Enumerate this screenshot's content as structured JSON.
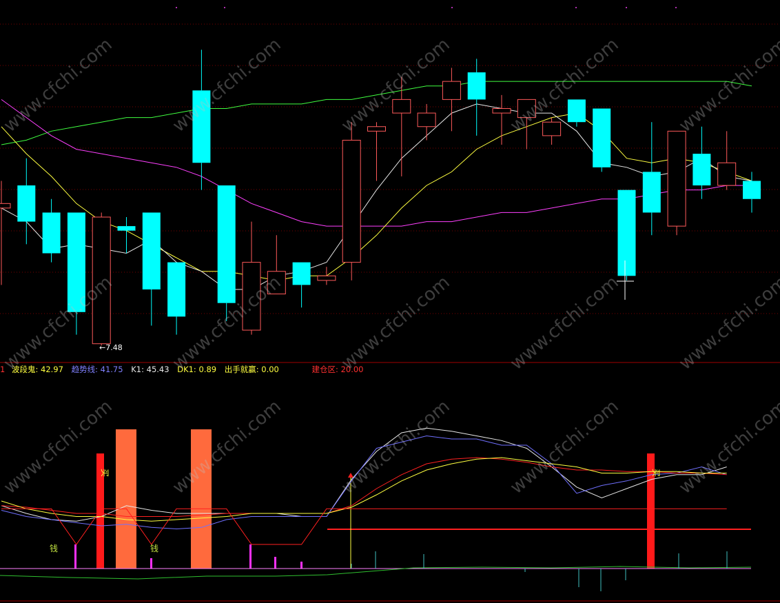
{
  "colors": {
    "background": "#000000",
    "up_candle": "#ff5a5a",
    "down_candle": "#00ffff",
    "grid": "#7a0000",
    "separator": "#a00000",
    "ma_white": "#e8e8e8",
    "ma_yellow": "#ffff40",
    "ma_magenta": "#ff40ff",
    "ma_green": "#40ff40"
  },
  "price_panel": {
    "low_marker": "←7.48"
  },
  "indicator_panel": {
    "prefix": "1",
    "legend": [
      {
        "label": "波段鬼: ",
        "value": "42.97",
        "color": "#ffff40",
        "label_color": "#ffff40"
      },
      {
        "label": "趋势线: ",
        "value": "41.75",
        "color": "#8080ff",
        "label_color": "#8080ff"
      },
      {
        "label": "K1: ",
        "value": "45.43",
        "color": "#e8e8e8",
        "label_color": "#e8e8e8"
      },
      {
        "label": "DK1: ",
        "value": "0.89",
        "color": "#ffff40",
        "label_color": "#ffff40"
      },
      {
        "label": "出手就赢: ",
        "value": "0.00",
        "color": "#ffff40",
        "label_color": "#ffff40"
      },
      {
        "label": "建仓区: ",
        "value": "20.00",
        "color": "#ff3030",
        "label_color": "#ff3030"
      }
    ],
    "marker_text_money": "钱",
    "marker_text_buy": "买"
  },
  "watermark": "www.cfchi.com",
  "chart_data": {
    "type": "candlestick",
    "candles": [
      {
        "o": 9.05,
        "h": 9.3,
        "l": 8.15,
        "c": 9.0,
        "dir": "up"
      },
      {
        "o": 9.25,
        "h": 9.55,
        "l": 8.6,
        "c": 8.85,
        "dir": "down"
      },
      {
        "o": 8.95,
        "h": 9.1,
        "l": 8.4,
        "c": 8.5,
        "dir": "down"
      },
      {
        "o": 8.95,
        "h": 8.95,
        "l": 7.6,
        "c": 7.85,
        "dir": "down"
      },
      {
        "o": 7.5,
        "h": 8.95,
        "l": 7.48,
        "c": 8.9,
        "dir": "up"
      },
      {
        "o": 8.8,
        "h": 8.9,
        "l": 8.5,
        "c": 8.75,
        "dir": "down"
      },
      {
        "o": 8.95,
        "h": 8.95,
        "l": 7.7,
        "c": 8.1,
        "dir": "down"
      },
      {
        "o": 8.4,
        "h": 8.4,
        "l": 7.6,
        "c": 7.8,
        "dir": "down"
      },
      {
        "o": 10.3,
        "h": 10.75,
        "l": 9.2,
        "c": 9.5,
        "dir": "down"
      },
      {
        "o": 9.25,
        "h": 9.25,
        "l": 7.75,
        "c": 7.95,
        "dir": "down"
      },
      {
        "o": 7.65,
        "h": 8.85,
        "l": 7.6,
        "c": 8.4,
        "dir": "up"
      },
      {
        "o": 8.05,
        "h": 8.7,
        "l": 8.05,
        "c": 8.3,
        "dir": "up"
      },
      {
        "o": 8.4,
        "h": 8.4,
        "l": 7.9,
        "c": 8.15,
        "dir": "down"
      },
      {
        "o": 8.2,
        "h": 8.35,
        "l": 8.15,
        "c": 8.25,
        "dir": "up"
      },
      {
        "o": 8.4,
        "h": 9.95,
        "l": 8.2,
        "c": 9.75,
        "dir": "up"
      },
      {
        "o": 9.85,
        "h": 9.95,
        "l": 9.3,
        "c": 9.9,
        "dir": "up"
      },
      {
        "o": 10.05,
        "h": 10.45,
        "l": 9.35,
        "c": 10.2,
        "dir": "up"
      },
      {
        "o": 9.9,
        "h": 10.15,
        "l": 9.75,
        "c": 10.05,
        "dir": "up"
      },
      {
        "o": 10.2,
        "h": 10.55,
        "l": 9.85,
        "c": 10.4,
        "dir": "up"
      },
      {
        "o": 10.5,
        "h": 10.65,
        "l": 9.8,
        "c": 10.2,
        "dir": "down"
      },
      {
        "o": 10.1,
        "h": 10.25,
        "l": 9.7,
        "c": 10.05,
        "dir": "up"
      },
      {
        "o": 10.2,
        "h": 10.2,
        "l": 9.65,
        "c": 10.0,
        "dir": "up"
      },
      {
        "o": 9.8,
        "h": 10.0,
        "l": 9.7,
        "c": 9.95,
        "dir": "up"
      },
      {
        "o": 10.2,
        "h": 10.2,
        "l": 9.9,
        "c": 9.95,
        "dir": "down"
      },
      {
        "o": 10.1,
        "h": 10.1,
        "l": 9.4,
        "c": 9.45,
        "dir": "down"
      },
      {
        "o": 9.2,
        "h": 9.2,
        "l": 8.2,
        "c": 8.25,
        "dir": "down"
      },
      {
        "o": 9.4,
        "h": 9.95,
        "l": 8.7,
        "c": 8.95,
        "dir": "down"
      },
      {
        "o": 8.8,
        "h": 9.85,
        "l": 8.7,
        "c": 9.85,
        "dir": "up"
      },
      {
        "o": 9.6,
        "h": 9.9,
        "l": 9.1,
        "c": 9.25,
        "dir": "down"
      },
      {
        "o": 9.25,
        "h": 9.85,
        "l": 9.2,
        "c": 9.5,
        "dir": "up"
      },
      {
        "o": 9.3,
        "h": 9.4,
        "l": 8.95,
        "c": 9.1,
        "dir": "down"
      }
    ],
    "ma_white": [
      9.0,
      8.85,
      8.55,
      8.6,
      8.55,
      8.5,
      8.65,
      8.4,
      8.3,
      8.1,
      8.1,
      8.25,
      8.3,
      8.4,
      8.8,
      9.2,
      9.55,
      9.8,
      10.05,
      10.15,
      10.1,
      10.05,
      10.05,
      9.85,
      9.5,
      9.45,
      9.35,
      9.4,
      9.55,
      9.35,
      9.3
    ],
    "ma_yellow": [
      9.9,
      9.6,
      9.35,
      9.05,
      8.85,
      8.75,
      8.6,
      8.45,
      8.3,
      8.3,
      8.25,
      8.2,
      8.25,
      8.25,
      8.45,
      8.7,
      9.0,
      9.25,
      9.4,
      9.65,
      9.8,
      9.9,
      10.0,
      10.05,
      9.85,
      9.55,
      9.5,
      9.55,
      9.5,
      9.4,
      9.3
    ],
    "ma_magenta": [
      10.2,
      10.0,
      9.8,
      9.65,
      9.6,
      9.55,
      9.5,
      9.45,
      9.35,
      9.2,
      9.05,
      8.95,
      8.85,
      8.8,
      8.8,
      8.8,
      8.8,
      8.85,
      8.85,
      8.9,
      8.95,
      8.95,
      9.0,
      9.05,
      9.1,
      9.1,
      9.15,
      9.2,
      9.2,
      9.25,
      9.25
    ],
    "ma_green": [
      9.7,
      9.75,
      9.85,
      9.9,
      9.95,
      10.0,
      10.0,
      10.05,
      10.1,
      10.1,
      10.15,
      10.15,
      10.15,
      10.2,
      10.2,
      10.25,
      10.3,
      10.35,
      10.35,
      10.4,
      10.4,
      10.4,
      10.4,
      10.4,
      10.4,
      10.4,
      10.4,
      10.4,
      10.4,
      10.4,
      10.35
    ],
    "indicator": {
      "k1_white": [
        45,
        40,
        36,
        35,
        38,
        45,
        42,
        40,
        40,
        40,
        40,
        40,
        38,
        38,
        62,
        80,
        92,
        95,
        93,
        90,
        87,
        82,
        70,
        57,
        50,
        56,
        62,
        65,
        65,
        70
      ],
      "trend_blue": [
        42,
        38,
        36,
        34,
        32,
        33,
        31,
        30,
        31,
        36,
        38,
        38,
        38,
        38,
        61,
        82,
        86,
        90,
        88,
        88,
        84,
        84,
        72,
        53,
        58,
        61,
        65,
        66,
        70,
        65
      ],
      "wave_yellow": [
        48,
        43,
        40,
        38,
        38,
        36,
        35,
        36,
        37,
        38,
        40,
        40,
        40,
        40,
        44,
        52,
        61,
        68,
        72,
        75,
        76,
        74,
        72,
        70,
        66,
        66,
        67,
        67,
        66,
        66
      ],
      "red_line": [
        45,
        44,
        42,
        40,
        40,
        38,
        38,
        38,
        39,
        40,
        40,
        40,
        40,
        40,
        45,
        56,
        65,
        72,
        75,
        76,
        75,
        73,
        70,
        68,
        68,
        67,
        67,
        66,
        66,
        65
      ],
      "red_step": [
        43,
        43,
        43,
        20,
        43,
        43,
        20,
        43,
        43,
        43,
        20,
        20,
        20,
        43,
        43,
        43,
        43,
        43,
        43,
        43,
        43,
        43,
        43,
        43,
        43,
        43,
        43,
        43,
        43,
        43
      ],
      "jiancang_level": 20.0
    }
  }
}
